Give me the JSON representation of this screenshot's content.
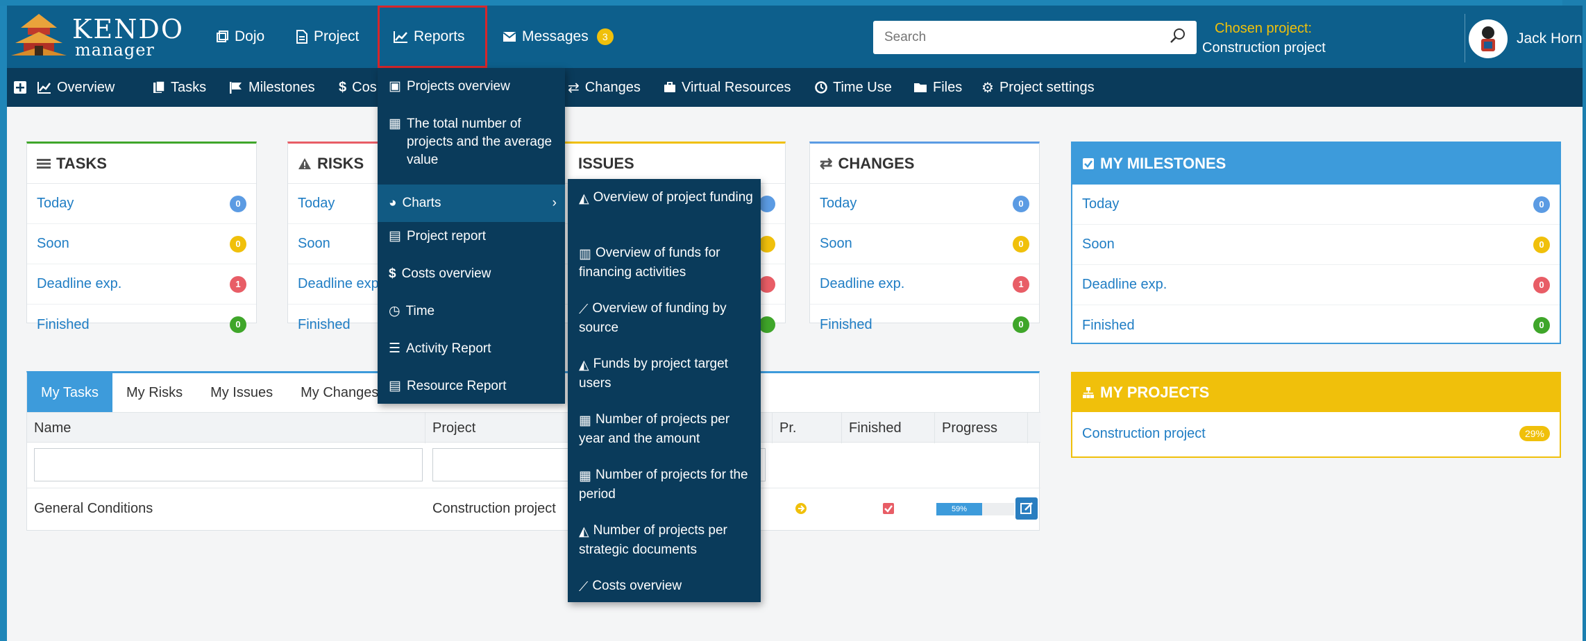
{
  "logo": {
    "title": "KENDO",
    "subtitle": "manager"
  },
  "topnav": {
    "dojo": "Dojo",
    "project": "Project",
    "reports": "Reports",
    "messages": "Messages",
    "messages_count": "3"
  },
  "search": {
    "placeholder": "Search"
  },
  "chosen_project": {
    "label": "Chosen project:",
    "value": "Construction project"
  },
  "user": {
    "name": "Jack Horn"
  },
  "subnav": {
    "overview": "Overview",
    "tasks": "Tasks",
    "milestones": "Milestones",
    "costs": "Cos",
    "changes": "Changes",
    "virtual_resources": "Virtual Resources",
    "time_use": "Time Use",
    "files": "Files",
    "project_settings": "Project settings"
  },
  "cards": {
    "tasks": {
      "title": "TASKS",
      "rows": [
        {
          "label": "Today",
          "count": "0"
        },
        {
          "label": "Soon",
          "count": "0"
        },
        {
          "label": "Deadline exp.",
          "count": "1"
        },
        {
          "label": "Finished",
          "count": "0"
        }
      ]
    },
    "risks": {
      "title": "RISKS",
      "rows": [
        {
          "label": "Today"
        },
        {
          "label": "Soon"
        },
        {
          "label": "Deadline exp."
        },
        {
          "label": "Finished"
        }
      ]
    },
    "issues": {
      "title": "ISSUES"
    },
    "changes": {
      "title": "CHANGES",
      "rows": [
        {
          "label": "Today",
          "count": "0"
        },
        {
          "label": "Soon",
          "count": "0"
        },
        {
          "label": "Deadline exp.",
          "count": "1"
        },
        {
          "label": "Finished",
          "count": "0"
        }
      ]
    },
    "milestones": {
      "title": "MY MILESTONES",
      "rows": [
        {
          "label": "Today",
          "count": "0"
        },
        {
          "label": "Soon",
          "count": "0"
        },
        {
          "label": "Deadline exp.",
          "count": "0"
        },
        {
          "label": "Finished",
          "count": "0"
        }
      ]
    }
  },
  "my_projects": {
    "title": "MY PROJECTS",
    "items": [
      {
        "name": "Construction project",
        "percent": "29%"
      }
    ]
  },
  "tabs": [
    "My Tasks",
    "My Risks",
    "My Issues",
    "My Changes"
  ],
  "table": {
    "headers": {
      "name": "Name",
      "project": "Project",
      "pr": "Pr.",
      "finished": "Finished",
      "progress": "Progress"
    },
    "rows": [
      {
        "name": "General Conditions",
        "project": "Construction project",
        "progress_label": "59%",
        "progress": 0.59
      }
    ]
  },
  "reports_menu": [
    "Projects overview",
    "The total number of projects and the average value",
    "Charts",
    "Project report",
    "Costs overview",
    "Time",
    "Activity Report",
    "Resource Report"
  ],
  "charts_submenu": [
    "Overview of project funding",
    "Overview of funds for financing activities",
    "Overview of funding by source",
    "Funds by project target users",
    "Number of projects per year and the amount",
    "Number of projects for the period",
    "Number of projects per strategic documents",
    "Costs overview"
  ],
  "colors": {
    "topbar": "#0d5f8c",
    "subnav": "#0a3b5b",
    "accent_blue": "#3d9bdb",
    "accent_yellow": "#f0c00b",
    "highlight_red": "#d6262b"
  }
}
